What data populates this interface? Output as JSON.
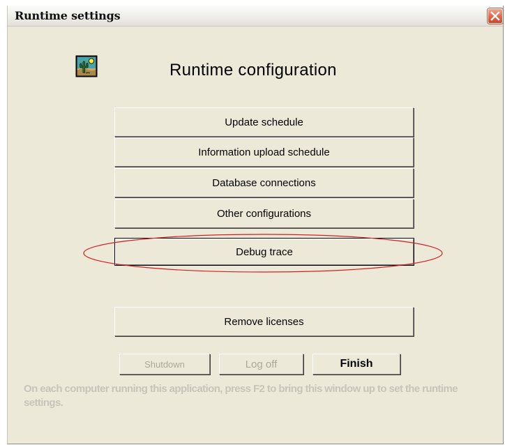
{
  "window": {
    "title": "Runtime settings",
    "close_icon": "close-icon"
  },
  "header": {
    "app_icon": "cactus-landscape-icon",
    "heading": "Runtime configuration"
  },
  "menu": {
    "update_schedule": "Update schedule",
    "information_upload_schedule": "Information upload schedule",
    "database_connections": "Database connections",
    "other_configurations": "Other configurations",
    "debug_trace": "Debug trace",
    "remove_licenses": "Remove licenses"
  },
  "footer_buttons": {
    "shutdown": "Shutdown",
    "log_off": "Log off",
    "finish": "Finish"
  },
  "hint_text": "On each computer running this application, press F2 to bring this window up to set the runtime settings.",
  "colors": {
    "dialog_background": "#ece9d8",
    "annotation_ellipse": "#d42020",
    "disabled_text": "#aca899"
  }
}
